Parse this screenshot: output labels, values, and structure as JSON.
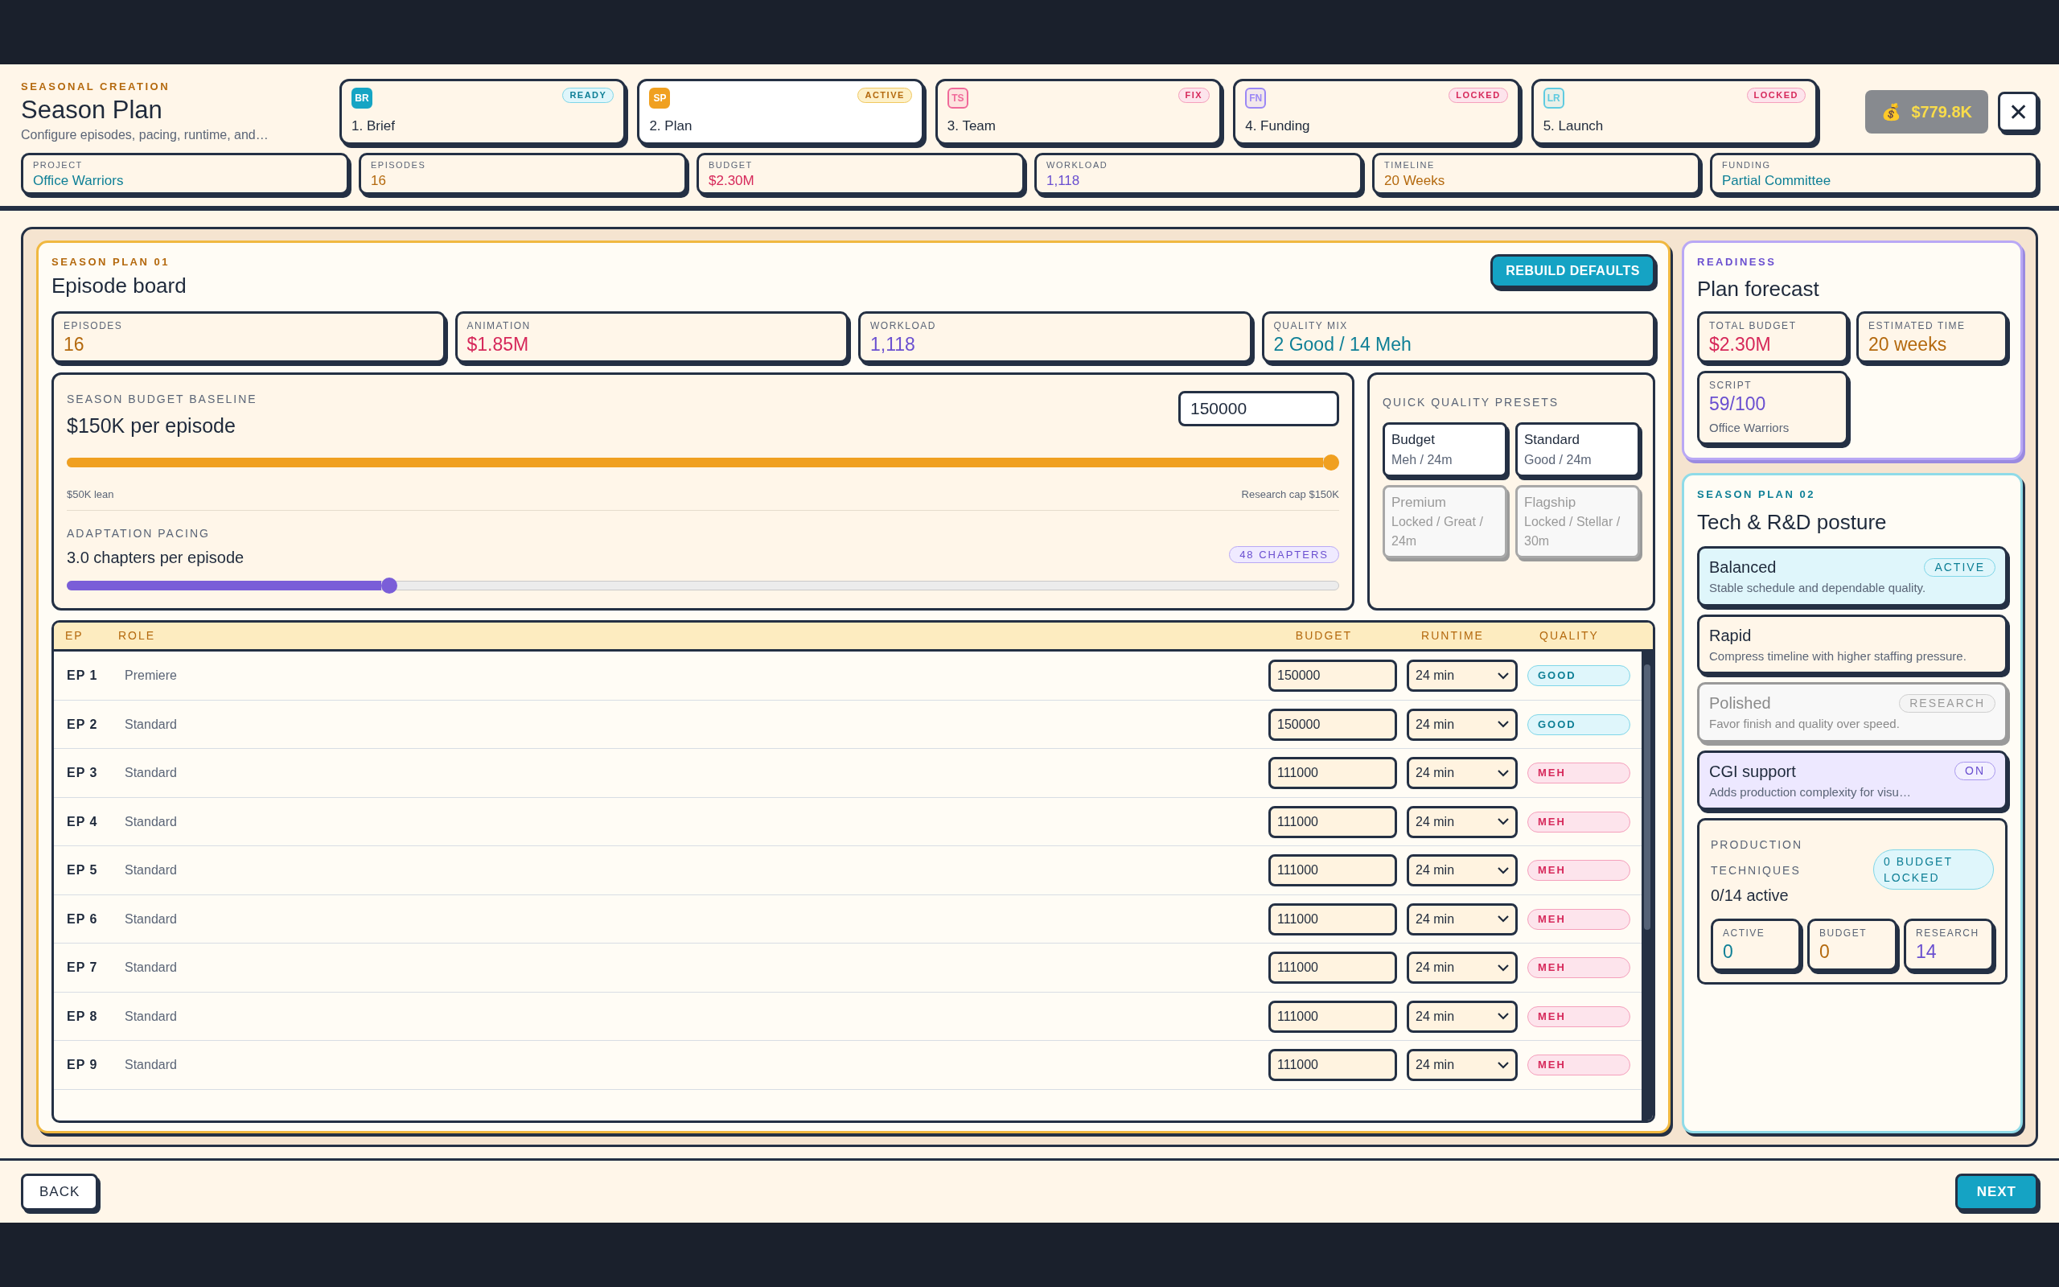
{
  "header": {
    "eyebrow": "SEASONAL CREATION",
    "title": "Season Plan",
    "subtitle": "Configure episodes, pacing, runtime, and…"
  },
  "steps": [
    {
      "code": "BR",
      "label": "1. Brief",
      "status": "READY",
      "kind": "ready",
      "color": "#16a5c4",
      "selected": false
    },
    {
      "code": "SP",
      "label": "2. Plan",
      "status": "ACTIVE",
      "kind": "active",
      "color": "#f0a020",
      "selected": true
    },
    {
      "code": "TS",
      "label": "3. Team",
      "status": "FIX",
      "kind": "fix",
      "color": "#f06a9a",
      "selected": false
    },
    {
      "code": "FN",
      "label": "4. Funding",
      "status": "LOCKED",
      "kind": "locked",
      "color": "#9b87f5",
      "selected": false
    },
    {
      "code": "LR",
      "label": "5. Launch",
      "status": "LOCKED",
      "kind": "locked",
      "color": "#5fcbe0",
      "selected": false
    }
  ],
  "wallet": {
    "icon": "💰",
    "amount": "$779.8K"
  },
  "close": "✕",
  "summary": [
    {
      "label": "PROJECT",
      "value": "Office Warriors",
      "kind": "teal"
    },
    {
      "label": "EPISODES",
      "value": "16",
      "kind": "amber"
    },
    {
      "label": "BUDGET",
      "value": "$2.30M",
      "kind": "rose"
    },
    {
      "label": "WORKLOAD",
      "value": "1,118",
      "kind": "violet"
    },
    {
      "label": "TIMELINE",
      "value": "20 Weeks",
      "kind": "amber"
    },
    {
      "label": "FUNDING",
      "value": "Partial Committee",
      "kind": "teal"
    }
  ],
  "board": {
    "eyebrow": "SEASON PLAN 01",
    "title": "Episode board",
    "action": "REBUILD DEFAULTS",
    "metrics": [
      {
        "label": "EPISODES",
        "value": "16",
        "kind": "amber"
      },
      {
        "label": "ANIMATION",
        "value": "$1.85M",
        "kind": "rose"
      },
      {
        "label": "WORKLOAD",
        "value": "1,118",
        "kind": "violet"
      },
      {
        "label": "QUALITY MIX",
        "value": "2 Good / 14 Meh",
        "kind": "teal"
      }
    ],
    "budget": {
      "label": "SEASON BUDGET BASELINE",
      "value": "$150K per episode",
      "input": "150000",
      "level": 1,
      "min_label": "$50K lean",
      "max_label": "Research cap $150K"
    },
    "pacing": {
      "label": "ADAPTATION PACING",
      "value": "3.0 chapters per episode",
      "badge": "48 CHAPTERS",
      "level": 0.25
    },
    "presets": {
      "title": "QUICK QUALITY PRESETS",
      "items": [
        {
          "name": "Budget",
          "detail": "Meh / 24m",
          "locked": false
        },
        {
          "name": "Standard",
          "detail": "Good / 24m",
          "locked": false
        },
        {
          "name": "Premium",
          "detail": "Locked / Great / 24m",
          "locked": true
        },
        {
          "name": "Flagship",
          "detail": "Locked / Stellar / 30m",
          "locked": true
        }
      ]
    },
    "table": {
      "columns": [
        "EP",
        "ROLE",
        "BUDGET",
        "RUNTIME",
        "QUALITY"
      ],
      "rows": [
        {
          "ep": "EP 1",
          "role": "Premiere",
          "budget": "150000",
          "runtime": "24 min",
          "quality": "GOOD",
          "kind": "good"
        },
        {
          "ep": "EP 2",
          "role": "Standard",
          "budget": "150000",
          "runtime": "24 min",
          "quality": "GOOD",
          "kind": "good"
        },
        {
          "ep": "EP 3",
          "role": "Standard",
          "budget": "111000",
          "runtime": "24 min",
          "quality": "MEH",
          "kind": "meh"
        },
        {
          "ep": "EP 4",
          "role": "Standard",
          "budget": "111000",
          "runtime": "24 min",
          "quality": "MEH",
          "kind": "meh"
        },
        {
          "ep": "EP 5",
          "role": "Standard",
          "budget": "111000",
          "runtime": "24 min",
          "quality": "MEH",
          "kind": "meh"
        },
        {
          "ep": "EP 6",
          "role": "Standard",
          "budget": "111000",
          "runtime": "24 min",
          "quality": "MEH",
          "kind": "meh"
        },
        {
          "ep": "EP 7",
          "role": "Standard",
          "budget": "111000",
          "runtime": "24 min",
          "quality": "MEH",
          "kind": "meh"
        },
        {
          "ep": "EP 8",
          "role": "Standard",
          "budget": "111000",
          "runtime": "24 min",
          "quality": "MEH",
          "kind": "meh"
        },
        {
          "ep": "EP 9",
          "role": "Standard",
          "budget": "111000",
          "runtime": "24 min",
          "quality": "MEH",
          "kind": "meh"
        }
      ]
    }
  },
  "readiness": {
    "eyebrow": "READINESS",
    "title": "Plan forecast",
    "stats": [
      {
        "label": "TOTAL BUDGET",
        "value": "$2.30M",
        "kind": "rose"
      },
      {
        "label": "ESTIMATED TIME",
        "value": "20 weeks",
        "kind": "amber"
      },
      {
        "label": "SCRIPT",
        "value": "59/100",
        "kind": "violet",
        "note": "Office Warriors"
      }
    ]
  },
  "tech": {
    "eyebrow": "SEASON PLAN 02",
    "title": "Tech & R&D posture",
    "options": [
      {
        "name": "Balanced",
        "desc": "Stable schedule and dependable quality.",
        "badge": "ACTIVE",
        "kind": "active"
      },
      {
        "name": "Rapid",
        "desc": "Compress timeline with higher staffing pressure.",
        "kind": "normal"
      },
      {
        "name": "Polished",
        "desc": "Favor finish and quality over speed.",
        "badge": "RESEARCH",
        "kind": "locked"
      },
      {
        "name": "CGI support",
        "desc": "Adds production complexity for visu…",
        "badge": "ON",
        "kind": "toggle",
        "on": true
      }
    ],
    "production": {
      "label": "PRODUCTION TECHNIQUES",
      "value": "0/14 active",
      "badge": "0 BUDGET LOCKED",
      "stats": [
        {
          "label": "ACTIVE",
          "value": "0",
          "kind": "teal"
        },
        {
          "label": "BUDGET",
          "value": "0",
          "kind": "amber"
        },
        {
          "label": "RESEARCH",
          "value": "14",
          "kind": "violet"
        }
      ]
    }
  },
  "footer": {
    "back": "BACK",
    "next": "NEXT"
  }
}
